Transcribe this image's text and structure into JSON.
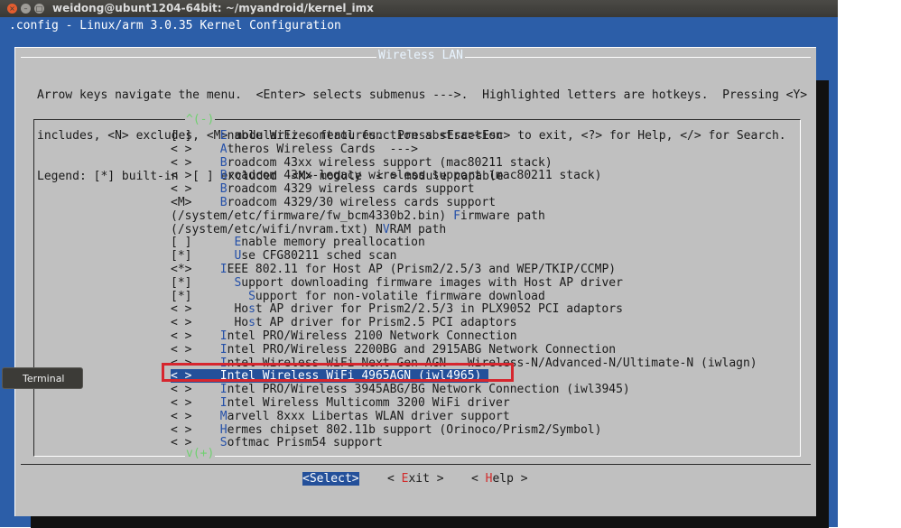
{
  "window": {
    "title": "weidong@ubunt1204-64bit: ~/myandroid/kernel_imx",
    "close_glyph": "×",
    "min_glyph": "–",
    "max_glyph": "□"
  },
  "header": ".config - Linux/arm 3.0.35 Kernel Configuration",
  "dialog": {
    "title": "Wireless LAN",
    "help_lines": [
      "Arrow keys navigate the menu.  <Enter> selects submenus --->.  Highlighted letters are hotkeys.  Pressing <Y>",
      "includes, <N> excludes, <M> modularizes features.  Press <Esc><Esc> to exit, <?> for Help, </> for Search.",
      "Legend: [*] built-in  [ ] excluded  <M> module  < > module capable"
    ],
    "scroll_up": "^(-)",
    "scroll_down": "v(+)"
  },
  "menu": [
    {
      "pre": "[ ]    ",
      "hk": "E",
      "post": "nable WiFi control function abstraction"
    },
    {
      "pre": "< >    ",
      "hk": "A",
      "post": "theros Wireless Cards  --->"
    },
    {
      "pre": "< >    ",
      "hk": "B",
      "post": "roadcom 43xx wireless support (mac80211 stack)"
    },
    {
      "pre": "< >    ",
      "hk": "B",
      "post": "roadcom 43xx-legacy wireless support (mac80211 stack)"
    },
    {
      "pre": "< >    ",
      "hk": "B",
      "post": "roadcom 4329 wireless cards support"
    },
    {
      "pre": "<M>    ",
      "hk": "B",
      "post": "roadcom 4329/30 wireless cards support"
    },
    {
      "pre": "(/system/etc/firmware/fw_bcm4330b2.bin) ",
      "hk": "F",
      "post": "irmware path"
    },
    {
      "pre": "(/system/etc/wifi/nvram.txt) N",
      "hk": "V",
      "post": "RAM path"
    },
    {
      "pre": "[ ]      ",
      "hk": "E",
      "post": "nable memory preallocation"
    },
    {
      "pre": "[*]      ",
      "hk": "U",
      "post": "se CFG80211 sched scan"
    },
    {
      "pre": "<*>    ",
      "hk": "I",
      "post": "EEE 802.11 for Host AP (Prism2/2.5/3 and WEP/TKIP/CCMP)"
    },
    {
      "pre": "[*]      ",
      "hk": "S",
      "post": "upport downloading firmware images with Host AP driver"
    },
    {
      "pre": "[*]        ",
      "hk": "S",
      "post": "upport for non-volatile firmware download"
    },
    {
      "pre": "< >      Ho",
      "hk": "s",
      "post": "t AP driver for Prism2/2.5/3 in PLX9052 PCI adaptors"
    },
    {
      "pre": "< >      Ho",
      "hk": "s",
      "post": "t AP driver for Prism2.5 PCI adaptors"
    },
    {
      "pre": "< >    ",
      "hk": "I",
      "post": "ntel PRO/Wireless 2100 Network Connection"
    },
    {
      "pre": "< >    ",
      "hk": "I",
      "post": "ntel PRO/Wireless 2200BG and 2915ABG Network Connection"
    },
    {
      "pre": "< >    ",
      "hk": "I",
      "post": "ntel Wireless WiFi Next Gen AGN - Wireless-N/Advanced-N/Ultimate-N (iwlagn)"
    },
    {
      "pre": "< >    ",
      "hk": "I",
      "post": "ntel Wireless WiFi 4965AGN (iwl4965)"
    },
    {
      "pre": "< >    ",
      "hk": "I",
      "post": "ntel PRO/Wireless 3945ABG/BG Network Connection (iwl3945)"
    },
    {
      "pre": "< >    ",
      "hk": "I",
      "post": "ntel Wireless Multicomm 3200 WiFi driver"
    },
    {
      "pre": "< >    ",
      "hk": "M",
      "post": "arvell 8xxx Libertas WLAN driver support"
    },
    {
      "pre": "< >    ",
      "hk": "H",
      "post": "ermes chipset 802.11b support (Orinoco/Prism2/Symbol)"
    },
    {
      "pre": "< >    ",
      "hk": "S",
      "post": "oftmac Prism54 support"
    }
  ],
  "selected_index": 18,
  "buttons": {
    "select": {
      "pre": "<",
      "hk": "S",
      "post": "elect>"
    },
    "exit": {
      "pre": "< ",
      "hk": "E",
      "post": "xit >"
    },
    "help": {
      "pre": "< ",
      "hk": "H",
      "post": "elp >"
    }
  },
  "tooltip": "Terminal",
  "colors": {
    "terminal_bg": "#2c5ea8",
    "dialog_bg": "#c0c0c0",
    "selection": "#24509a",
    "hotkey": "#2550a8",
    "button_hotkey": "#d22b2b",
    "highlight_box": "#d6262e"
  }
}
